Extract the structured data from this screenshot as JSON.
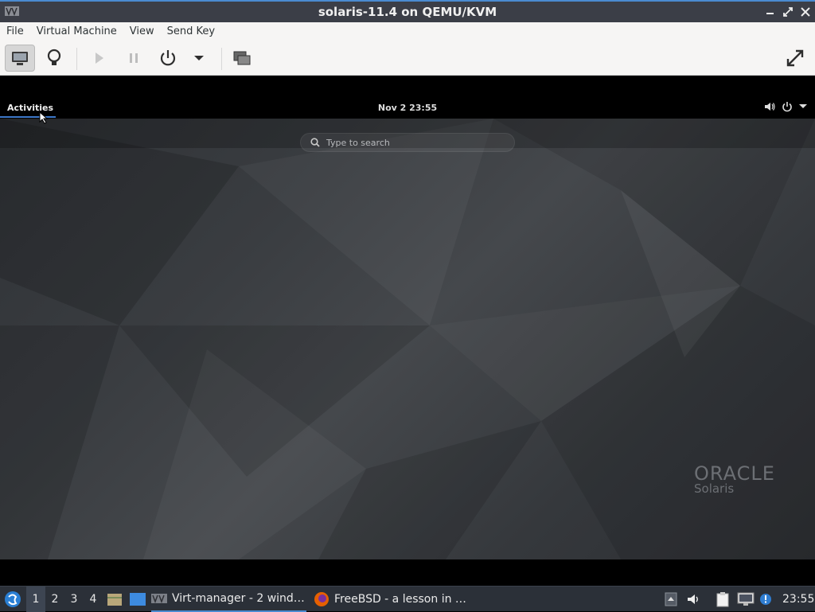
{
  "window": {
    "title": "solaris-11.4 on QEMU/KVM"
  },
  "menubar": {
    "items": [
      "File",
      "Virtual Machine",
      "View",
      "Send Key"
    ]
  },
  "guest": {
    "activities_label": "Activities",
    "clock": "Nov 2  23:55",
    "search": {
      "placeholder": "Type to search"
    },
    "logo": {
      "brand": "ORACLE",
      "product": "Solaris"
    }
  },
  "taskbar": {
    "workspaces": [
      "1",
      "2",
      "3",
      "4"
    ],
    "active_workspace": "1",
    "tasks": [
      {
        "label": "Virt-manager - 2 wind…",
        "icon": "virt-manager-icon",
        "active": true
      },
      {
        "label": "FreeBSD - a lesson in …",
        "icon": "firefox-icon",
        "active": false
      }
    ],
    "clock": "23:55"
  },
  "colors": {
    "titlebar": "#3b3e47",
    "accent": "#4a8bd1",
    "taskbar": "#2b3038"
  }
}
